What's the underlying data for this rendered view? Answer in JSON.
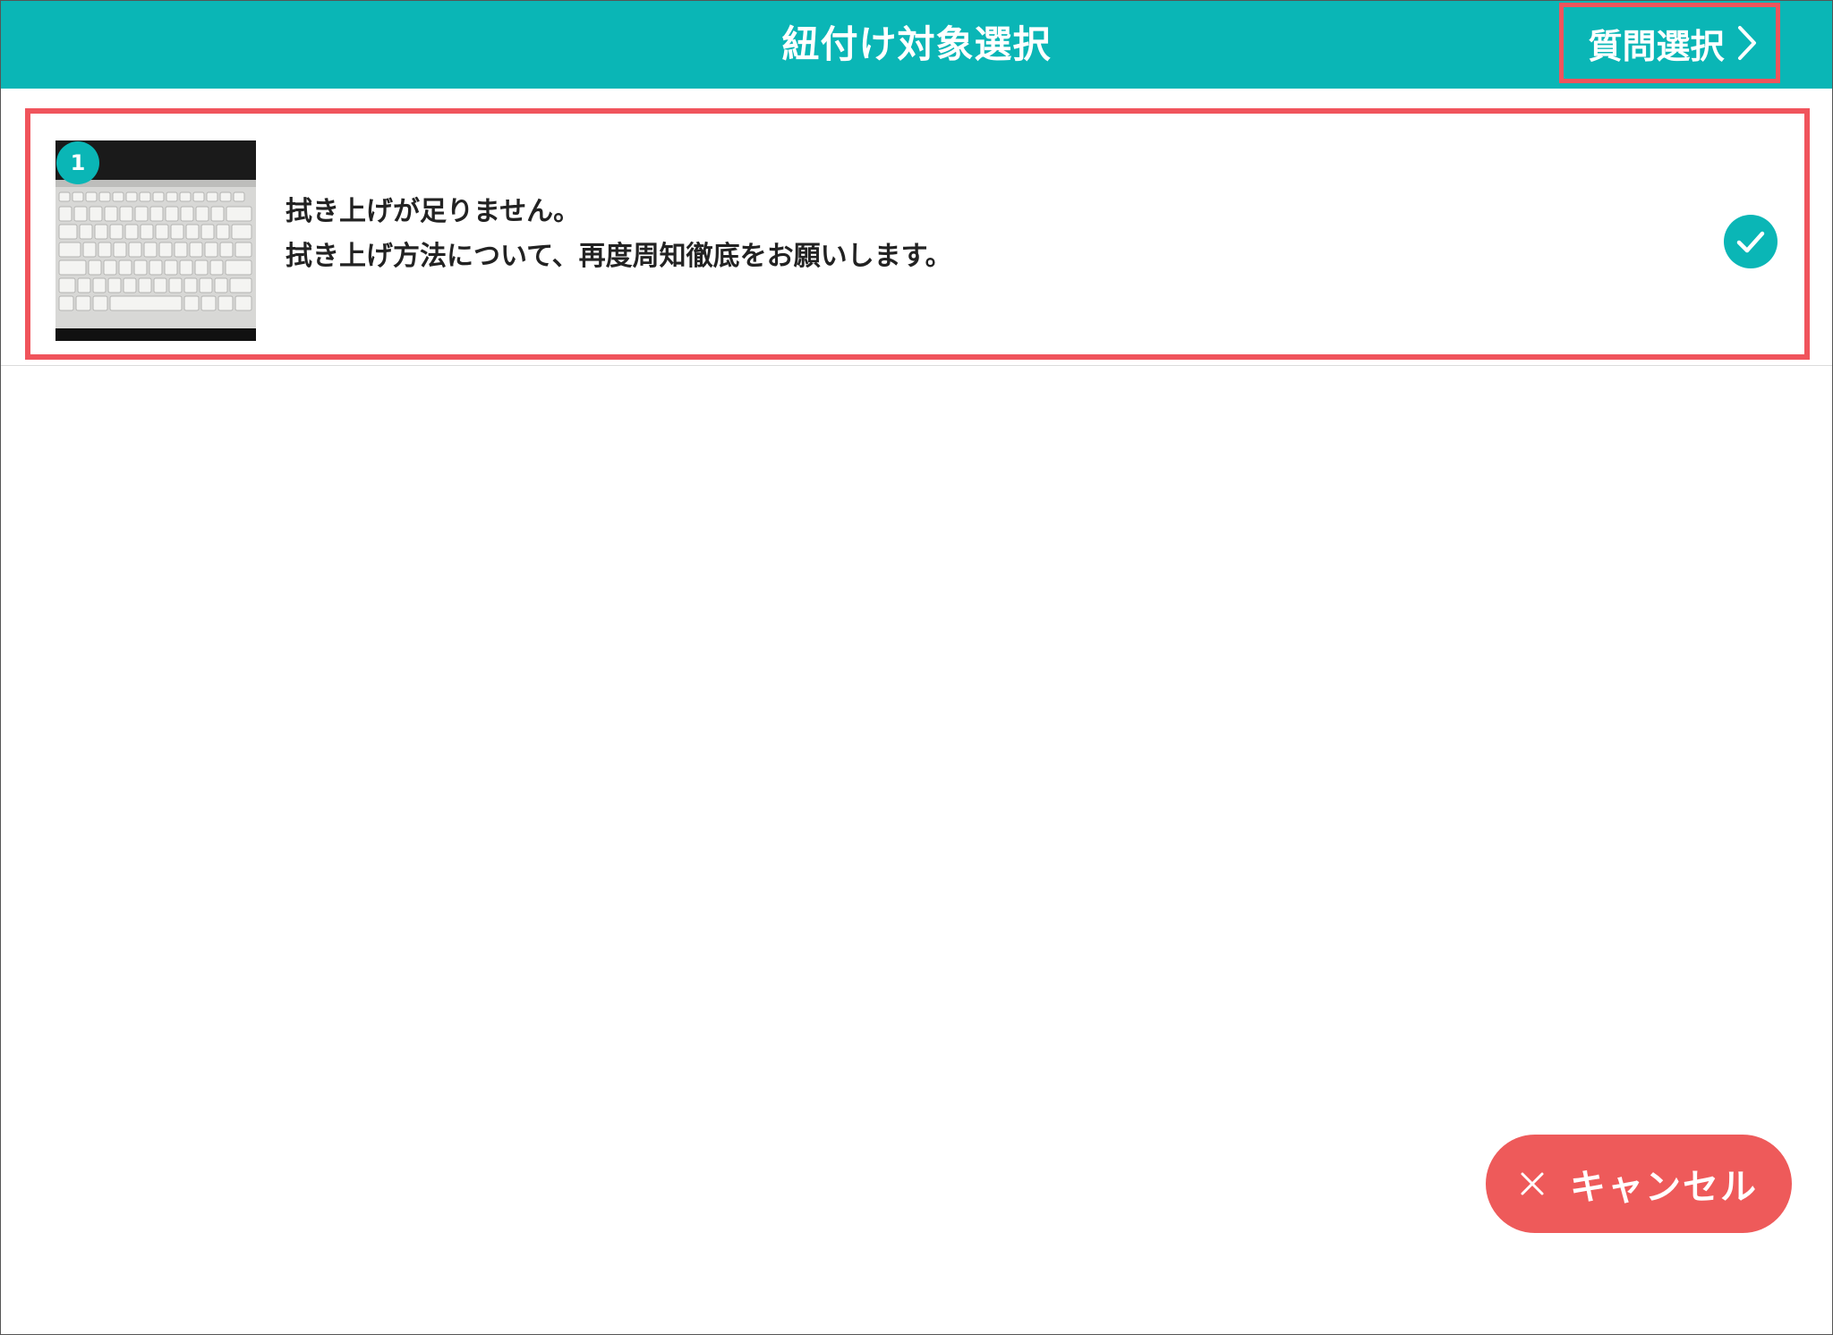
{
  "header": {
    "title": "紐付け対象選択",
    "next_label": "質問選択",
    "next_icon": "chevron-right-icon"
  },
  "items": [
    {
      "number": "1",
      "line1": "拭き上げが足りません。",
      "line2": "拭き上げ方法について、再度周知徹底をお願いします。",
      "selected": true,
      "thumbnail": "keyboard-photo"
    }
  ],
  "footer": {
    "cancel_label": "キャンセル",
    "cancel_icon": "close-icon"
  },
  "colors": {
    "accent": "#0ab6b6",
    "highlight": "#f0545c",
    "cancel": "#ee5a5a"
  }
}
